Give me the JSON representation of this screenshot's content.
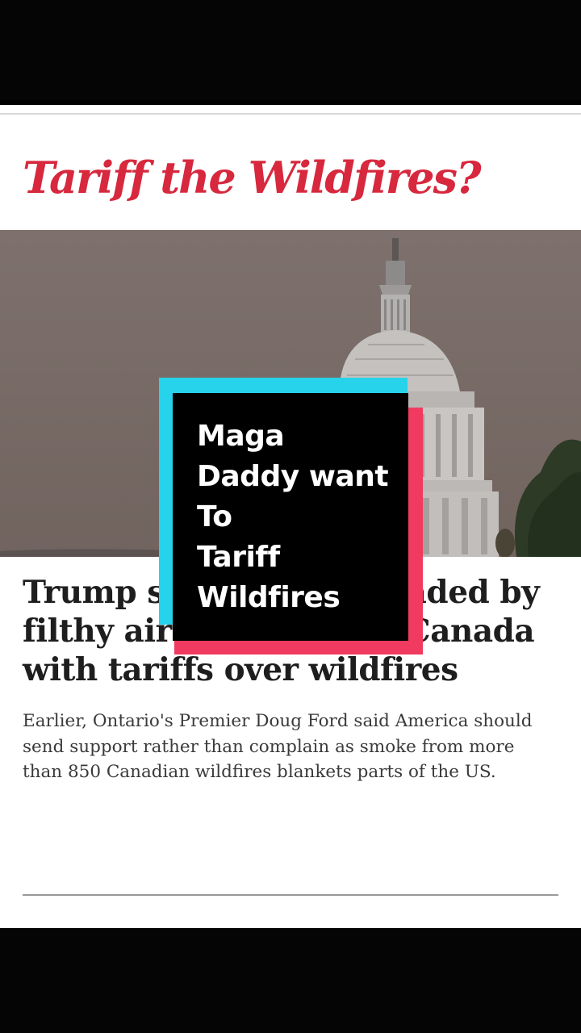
{
  "header": {
    "headline": "Tariff the Wildfires?"
  },
  "photo": {
    "subject": "capitol-dome-in-smoke"
  },
  "story": {
    "title": "Trump says US being invaded by filthy air from Canada, threatens Canada with tariffs over wildfires",
    "title_lines": [
      "Trump s",
      "aded by",
      "filthy air",
      "Canada",
      "with tariffs over wildfires"
    ],
    "body": "Earlier, Ontario's Premier Doug Ford said America should send support rather than complain as smoke from more than 850 Canadian wildfires blankets parts of the US."
  },
  "caption": {
    "lines": [
      "Maga",
      "Daddy want",
      "To",
      "Tariff",
      "Wildfires"
    ]
  },
  "colors": {
    "headline_red": "#d7283e",
    "caption_cyan": "#27d3ea",
    "caption_red": "#f03a5f",
    "caption_bg": "#000000",
    "caption_text": "#ffffff"
  }
}
